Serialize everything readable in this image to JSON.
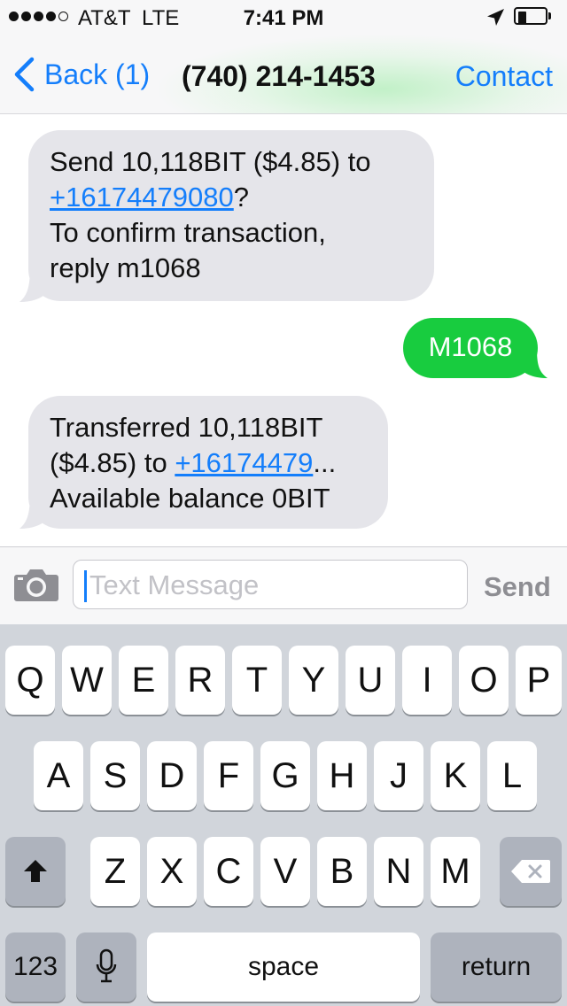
{
  "status_bar": {
    "carrier": "AT&T",
    "network": "LTE",
    "time": "7:41 PM",
    "signal_bars_filled": 4,
    "signal_bars_total": 5,
    "battery_level": 0.3,
    "icons": [
      "location-arrow-icon",
      "battery-icon"
    ]
  },
  "nav": {
    "back_label": "Back (1)",
    "title": "(740) 214-1453",
    "contact_label": "Contact"
  },
  "messages": [
    {
      "direction": "incoming",
      "lines": [
        {
          "text": "Send 10,118BIT ($4.85) to"
        },
        {
          "link": "+16174479080",
          "after": "?"
        },
        {
          "text": "To confirm transaction,"
        },
        {
          "text": "reply m1068"
        }
      ]
    },
    {
      "direction": "outgoing",
      "text": "M1068"
    },
    {
      "direction": "incoming",
      "lines": [
        {
          "text": "Transferred 10,118BIT"
        },
        {
          "before": "($4.85) to ",
          "link": "+16174479",
          "after": "..."
        },
        {
          "text": "Available balance 0BIT"
        }
      ]
    }
  ],
  "input": {
    "placeholder": "Text Message",
    "value": "",
    "send_label": "Send"
  },
  "keyboard": {
    "row1": [
      "Q",
      "W",
      "E",
      "R",
      "T",
      "Y",
      "U",
      "I",
      "O",
      "P"
    ],
    "row2": [
      "A",
      "S",
      "D",
      "F",
      "G",
      "H",
      "J",
      "K",
      "L"
    ],
    "row3": [
      "Z",
      "X",
      "C",
      "V",
      "B",
      "N",
      "M"
    ],
    "numbers_label": "123",
    "space_label": "space",
    "return_label": "return"
  },
  "colors": {
    "accent": "#147efb",
    "outgoing_bubble": "#18cc3f",
    "incoming_bubble": "#e5e5ea",
    "keyboard_bg": "#d1d5db"
  }
}
